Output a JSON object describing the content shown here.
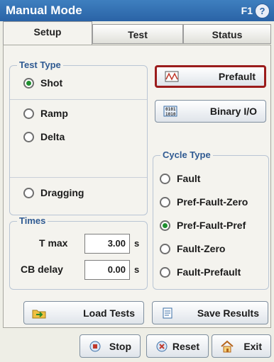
{
  "window": {
    "title": "Manual Mode",
    "hint": "F1",
    "help": "?"
  },
  "tabs": [
    {
      "label": "Setup",
      "active": true
    },
    {
      "label": "Test",
      "active": false
    },
    {
      "label": "Status",
      "active": false
    }
  ],
  "test_type": {
    "legend": "Test Type",
    "options": [
      {
        "label": "Shot",
        "selected": true
      },
      {
        "label": "Ramp",
        "selected": false
      },
      {
        "label": "Delta",
        "selected": false
      },
      {
        "label": "Dragging",
        "selected": false
      }
    ]
  },
  "side_buttons": {
    "prefault": "Prefault",
    "binary_io": "Binary I/O"
  },
  "cycle_type": {
    "legend": "Cycle Type",
    "options": [
      {
        "label": "Fault",
        "selected": false
      },
      {
        "label": "Pref-Fault-Zero",
        "selected": false
      },
      {
        "label": "Pref-Fault-Pref",
        "selected": true
      },
      {
        "label": "Fault-Zero",
        "selected": false
      },
      {
        "label": "Fault-Prefault",
        "selected": false
      }
    ]
  },
  "times": {
    "legend": "Times",
    "t_max": {
      "label": "T max",
      "value": "3.00",
      "unit": "s"
    },
    "cb_delay": {
      "label": "CB delay",
      "value": "0.00",
      "unit": "s"
    }
  },
  "actions": {
    "load_tests": "Load Tests",
    "save_results": "Save Results"
  },
  "bottom": {
    "stop": "Stop",
    "reset": "Reset",
    "exit": "Exit"
  },
  "colors": {
    "title_bar": "#2a63a6",
    "selected_radio": "#1f8f2f",
    "highlight_border": "#9b1c1c"
  }
}
